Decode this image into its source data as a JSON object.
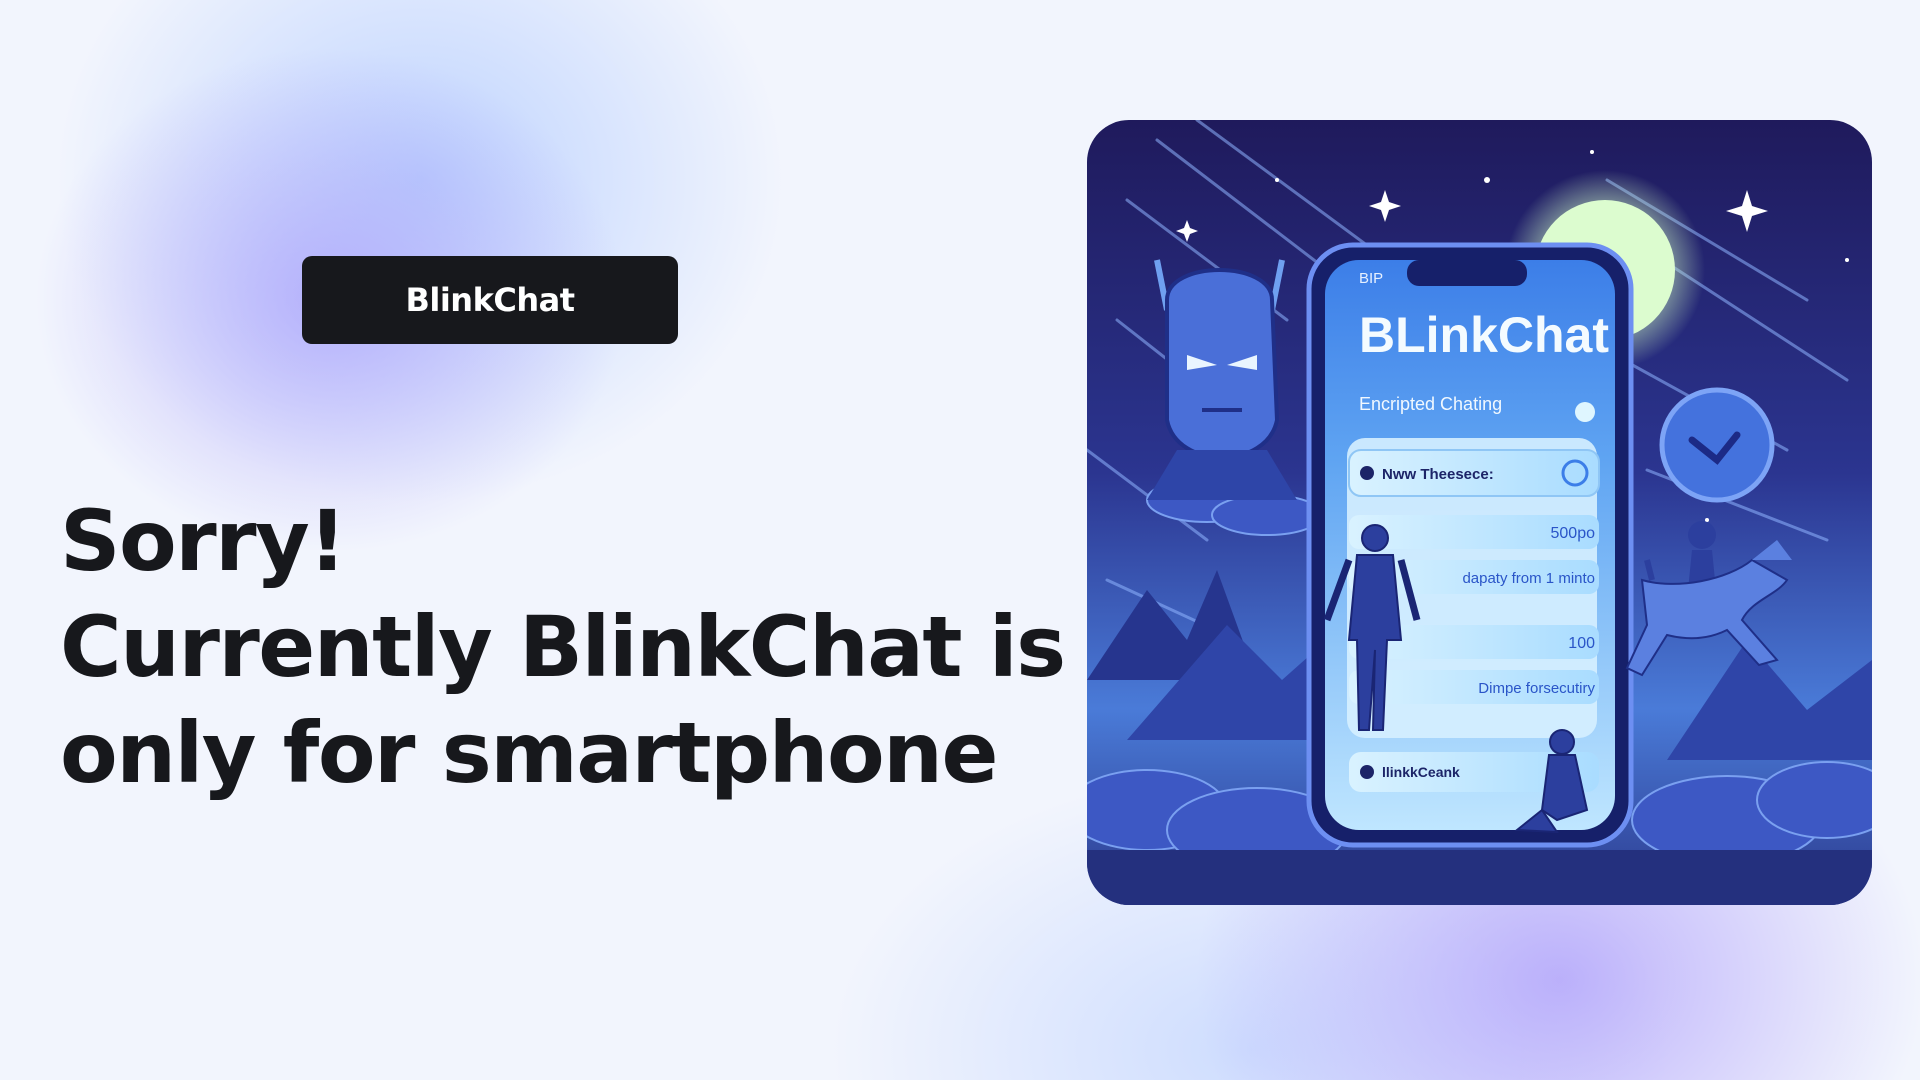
{
  "brand": {
    "button_label": "BlinkChat"
  },
  "message": {
    "line1": "Sorry!",
    "line2": "Currently BlinkChat is",
    "line3": "only for smartphone"
  },
  "illustration": {
    "phone_status": "BIP",
    "app_title": "BLinkChat",
    "subtitle": "Encripted Chating",
    "message_label": "Nww Theesece:",
    "stat_value": "500po",
    "delivery_text": "dapaty from 1 minto",
    "count_value": "100",
    "notice_text": "Dimpe forsecutiry",
    "footer_text": "llinkkCeank"
  },
  "colors": {
    "brand_button": "#17181c",
    "headline_text": "#17181c",
    "page_background": "#f2f5fd",
    "accent_purple": "#aaa0fa",
    "illustration_blue": "#3a4fc4"
  }
}
